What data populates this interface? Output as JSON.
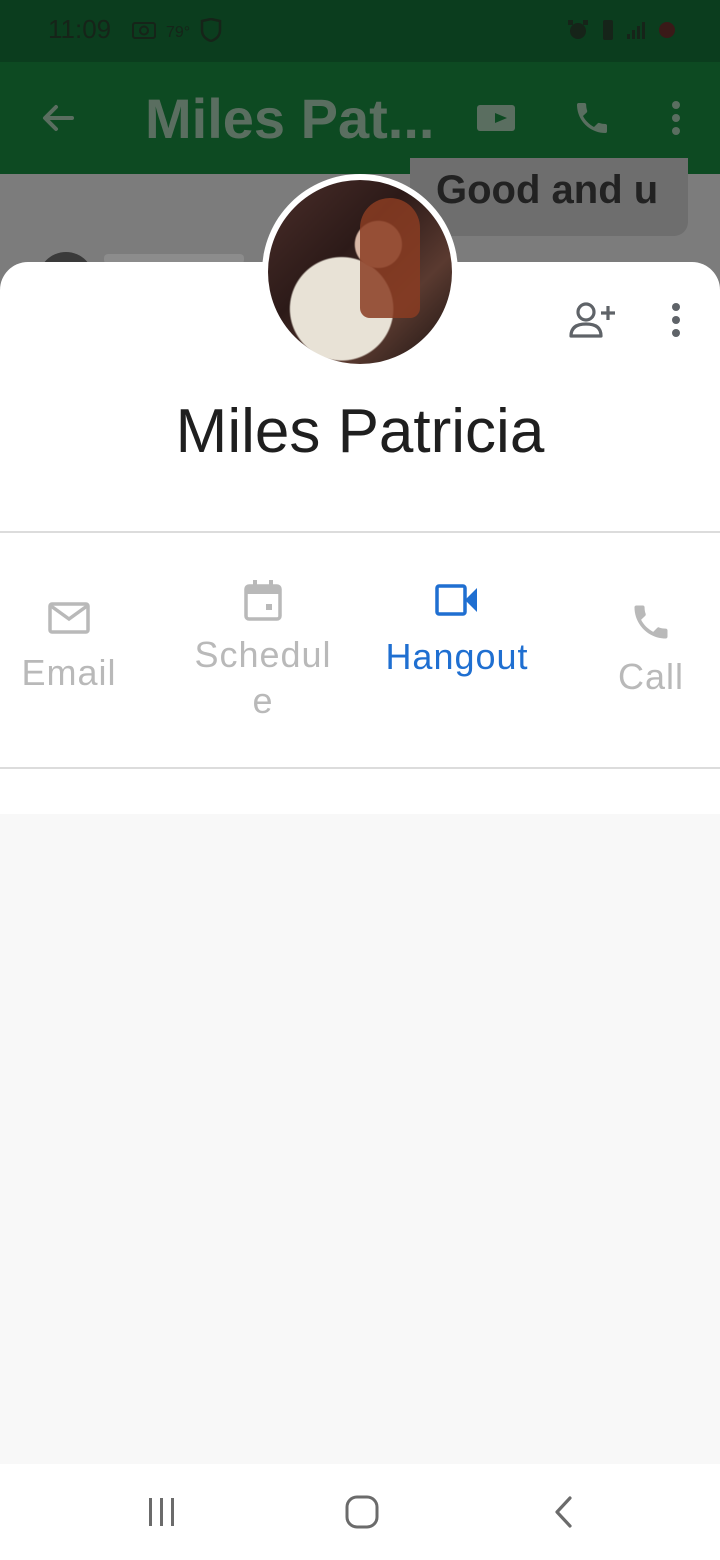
{
  "status": {
    "time": "11:09",
    "temperature": "79°"
  },
  "app_bar": {
    "title": "Miles Pat..."
  },
  "chat": {
    "bubble_text": "Good and u"
  },
  "contact": {
    "name": "Miles Patricia"
  },
  "actions": [
    {
      "label": "Email",
      "icon": "email-icon",
      "state": "disabled"
    },
    {
      "label": "Schedule",
      "icon": "calendar-icon",
      "state": "disabled"
    },
    {
      "label": "Hangout",
      "icon": "video-icon",
      "state": "active"
    },
    {
      "label": "Call",
      "icon": "phone-icon",
      "state": "disabled"
    }
  ],
  "colors": {
    "accent": "#1f6fd1",
    "disabled": "#b9b9b9",
    "app_bar": "#0d4a22"
  }
}
